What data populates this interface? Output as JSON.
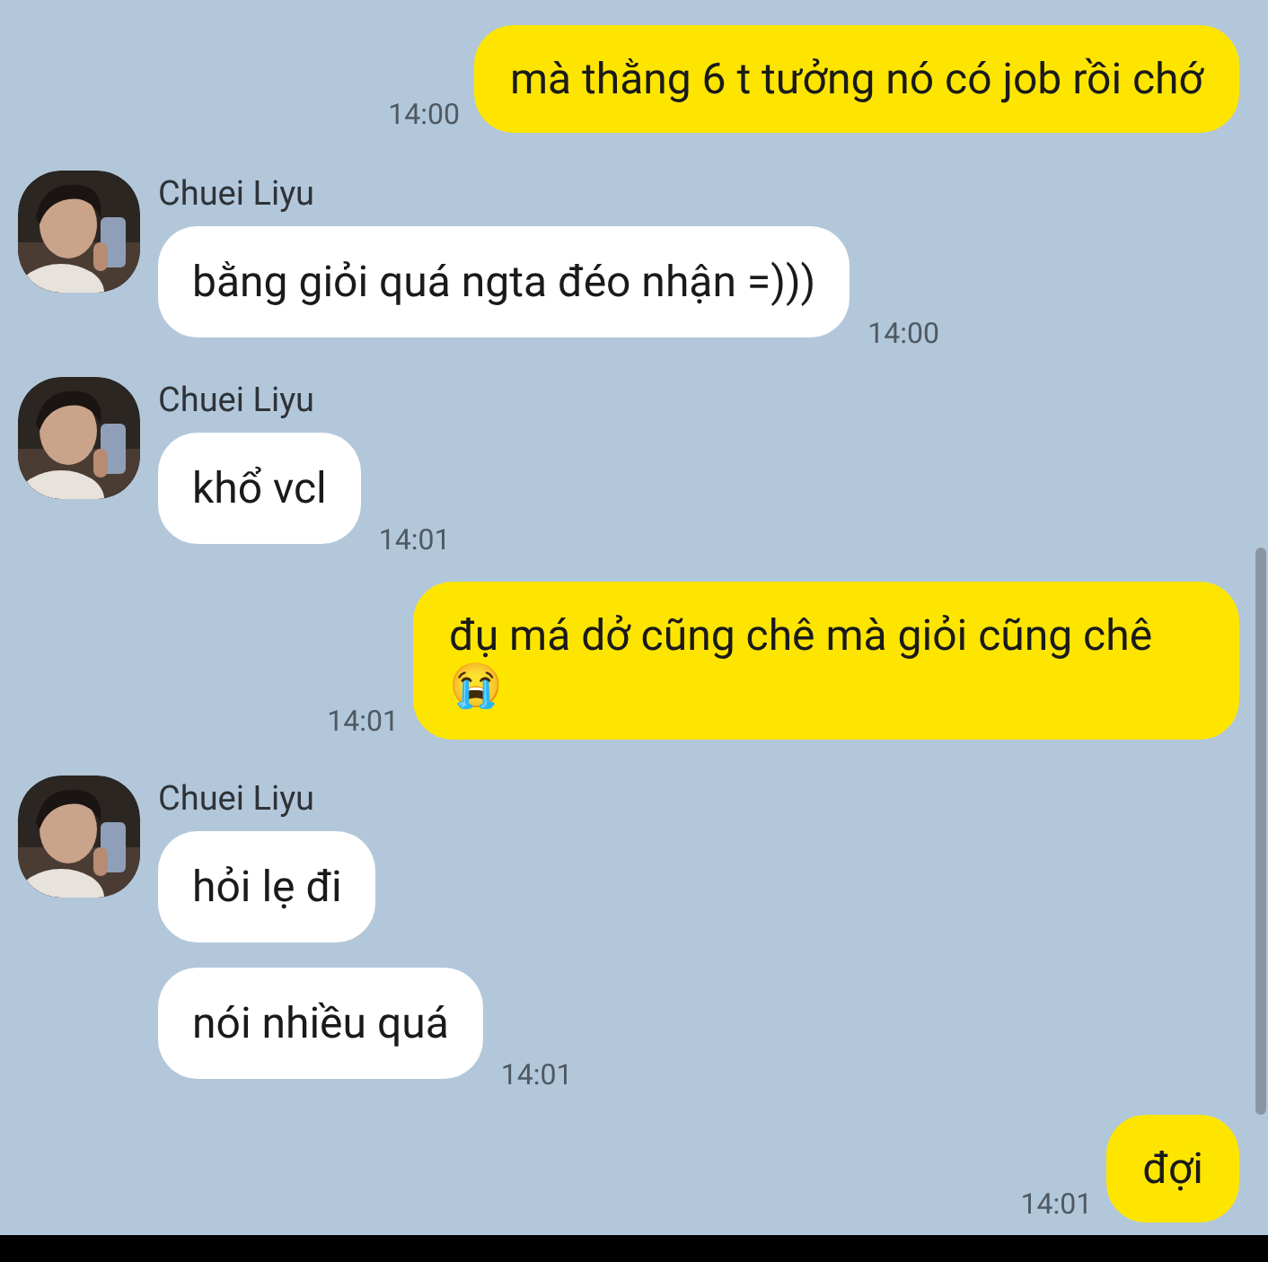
{
  "messages": [
    {
      "kind": "sent",
      "bubbles": [
        {
          "text": "mà thằng 6 t tưởng nó có job rồi chớ"
        }
      ],
      "time": "14:00"
    },
    {
      "kind": "received",
      "sender": "Chuei Liyu",
      "bubbles": [
        {
          "text": "bằng giỏi quá ngta đéo nhận =)))"
        }
      ],
      "time": "14:00"
    },
    {
      "kind": "received",
      "sender": "Chuei Liyu",
      "bubbles": [
        {
          "text": "khổ vcl"
        }
      ],
      "time": "14:01"
    },
    {
      "kind": "sent",
      "bubbles": [
        {
          "text": "đụ má dở cũng chê mà giỏi cũng chê 😭"
        }
      ],
      "time": "14:01"
    },
    {
      "kind": "received",
      "sender": "Chuei Liyu",
      "bubbles": [
        {
          "text": "hỏi lẹ đi"
        },
        {
          "text": "nói nhiều quá"
        }
      ],
      "time": "14:01"
    },
    {
      "kind": "sent",
      "bubbles": [
        {
          "text": "đợi"
        }
      ],
      "time": "14:01"
    }
  ]
}
